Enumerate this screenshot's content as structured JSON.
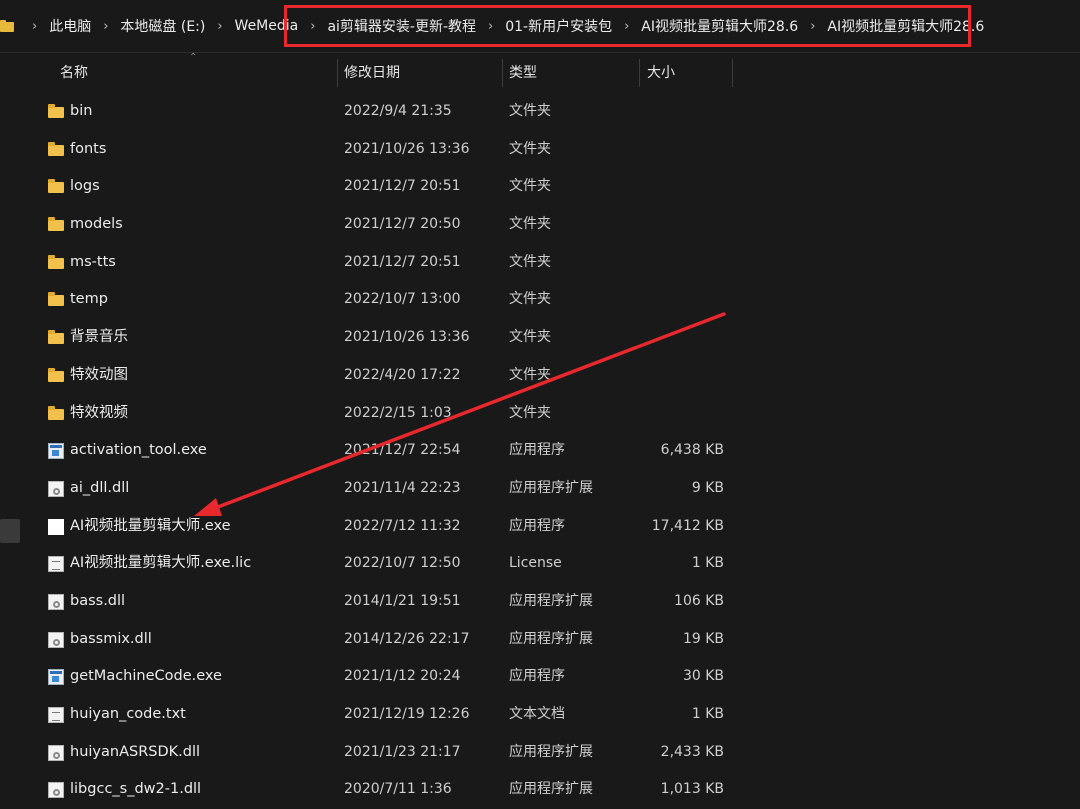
{
  "breadcrumb": {
    "items": [
      "此电脑",
      "本地磁盘 (E:)",
      "WeMedia",
      "ai剪辑器安装-更新-教程",
      "01-新用户安装包",
      "AI视频批量剪辑大师28.6",
      "AI视频批量剪辑大师28.6"
    ],
    "separator": "›"
  },
  "columns": {
    "name": "名称",
    "date": "修改日期",
    "type": "类型",
    "size": "大小"
  },
  "files": [
    {
      "icon": "folder-icon",
      "name": "bin",
      "date": "2022/9/4 21:35",
      "type": "文件夹",
      "size": ""
    },
    {
      "icon": "folder-icon",
      "name": "fonts",
      "date": "2021/10/26 13:36",
      "type": "文件夹",
      "size": ""
    },
    {
      "icon": "folder-icon",
      "name": "logs",
      "date": "2021/12/7 20:51",
      "type": "文件夹",
      "size": ""
    },
    {
      "icon": "folder-icon",
      "name": "models",
      "date": "2021/12/7 20:50",
      "type": "文件夹",
      "size": ""
    },
    {
      "icon": "folder-icon",
      "name": "ms-tts",
      "date": "2021/12/7 20:51",
      "type": "文件夹",
      "size": ""
    },
    {
      "icon": "folder-icon",
      "name": "temp",
      "date": "2022/10/7 13:00",
      "type": "文件夹",
      "size": ""
    },
    {
      "icon": "folder-icon",
      "name": "背景音乐",
      "date": "2021/10/26 13:36",
      "type": "文件夹",
      "size": ""
    },
    {
      "icon": "folder-icon",
      "name": "特效动图",
      "date": "2022/4/20 17:22",
      "type": "文件夹",
      "size": ""
    },
    {
      "icon": "folder-icon",
      "name": "特效视频",
      "date": "2022/2/15 1:03",
      "type": "文件夹",
      "size": ""
    },
    {
      "icon": "exe-icon",
      "name": "activation_tool.exe",
      "date": "2021/12/7 22:54",
      "type": "应用程序",
      "size": "6,438 KB"
    },
    {
      "icon": "dll-icon",
      "name": "ai_dll.dll",
      "date": "2021/11/4 22:23",
      "type": "应用程序扩展",
      "size": "9 KB"
    },
    {
      "icon": "blank-exe-icon",
      "name": "AI视频批量剪辑大师.exe",
      "date": "2022/7/12 11:32",
      "type": "应用程序",
      "size": "17,412 KB"
    },
    {
      "icon": "doc-icon",
      "name": "AI视频批量剪辑大师.exe.lic",
      "date": "2022/10/7 12:50",
      "type": "License",
      "size": "1 KB"
    },
    {
      "icon": "dll-icon",
      "name": "bass.dll",
      "date": "2014/1/21 19:51",
      "type": "应用程序扩展",
      "size": "106 KB"
    },
    {
      "icon": "dll-icon",
      "name": "bassmix.dll",
      "date": "2014/12/26 22:17",
      "type": "应用程序扩展",
      "size": "19 KB"
    },
    {
      "icon": "exe-icon",
      "name": "getMachineCode.exe",
      "date": "2021/1/12 20:24",
      "type": "应用程序",
      "size": "30 KB"
    },
    {
      "icon": "doc-icon",
      "name": "huiyan_code.txt",
      "date": "2021/12/19 12:26",
      "type": "文本文档",
      "size": "1 KB"
    },
    {
      "icon": "dll-icon",
      "name": "huiyanASRSDK.dll",
      "date": "2021/1/23 21:17",
      "type": "应用程序扩展",
      "size": "2,433 KB"
    },
    {
      "icon": "dll-icon",
      "name": "libgcc_s_dw2-1.dll",
      "date": "2020/7/11 1:36",
      "type": "应用程序扩展",
      "size": "1,013 KB"
    }
  ],
  "colors": {
    "highlight": "#e7282d",
    "background": "#191919",
    "folder": "#f1c14b"
  }
}
